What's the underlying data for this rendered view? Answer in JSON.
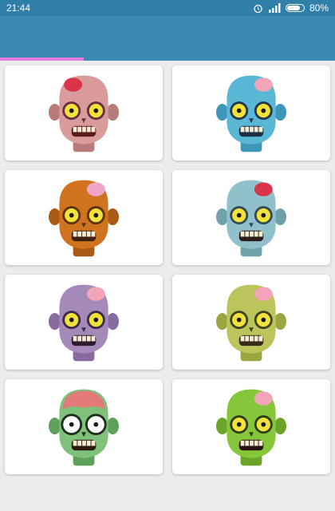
{
  "status_bar": {
    "time": "21:44",
    "battery_text": "80%",
    "battery_level": 0.8,
    "icons": [
      "alarm-icon",
      "signal-icon",
      "battery-icon"
    ]
  },
  "load_progress": 0.25,
  "colors": {
    "status_bar": "#2f7fa8",
    "app_bar": "#3b8ab3",
    "progress": "#e07be0"
  },
  "zombies": [
    {
      "name": "zombie-pink",
      "skin": "#d99b9b",
      "shade": "#b97a7a",
      "brain": "#d9344a",
      "eye": "#f1e33b",
      "ring": "#6a3040",
      "mouth": "#5a1b1b",
      "style": "angry"
    },
    {
      "name": "zombie-blue",
      "skin": "#5ab7d6",
      "shade": "#3e97b8",
      "brain": "#f2a4b8",
      "eye": "#f1e33b",
      "ring": "#26374f",
      "mouth": "#1c2f44",
      "style": "skull"
    },
    {
      "name": "zombie-orange",
      "skin": "#d0731f",
      "shade": "#a95a15",
      "brain": "#f0a4c8",
      "eye": "#f1e33b",
      "ring": "#5e3312",
      "mouth": "#3e2010",
      "style": "grin"
    },
    {
      "name": "zombie-lightblue",
      "skin": "#8fc0cc",
      "shade": "#6fa1ad",
      "brain": "#d9344a",
      "eye": "#f1e33b",
      "ring": "#364c55",
      "mouth": "#2a1d1d",
      "style": "grin"
    },
    {
      "name": "zombie-purple",
      "skin": "#a58ab9",
      "shade": "#876ba0",
      "brain": "#f2a4b8",
      "eye": "#f1e33b",
      "ring": "#3d2b4b",
      "mouth": "#2c1b2b",
      "style": "grin"
    },
    {
      "name": "zombie-yellowgreen",
      "skin": "#bcc55b",
      "shade": "#9ba541",
      "brain": "#f2a4b8",
      "eye": "#f1e33b",
      "ring": "#3f4320",
      "mouth": "#3a2a1a",
      "style": "skull"
    },
    {
      "name": "zombie-green-brain",
      "skin": "#7fc07a",
      "shade": "#5fa05a",
      "brain": "#e27a7a",
      "eye": "#ffffff",
      "ring": "#1f2f1f",
      "mouth": "#2a1a0a",
      "style": "brain"
    },
    {
      "name": "zombie-green",
      "skin": "#87c63a",
      "shade": "#6aa52a",
      "brain": "#f2a4b8",
      "eye": "#f1e33b",
      "ring": "#2f3f17",
      "mouth": "#2a1010",
      "style": "grin"
    }
  ]
}
